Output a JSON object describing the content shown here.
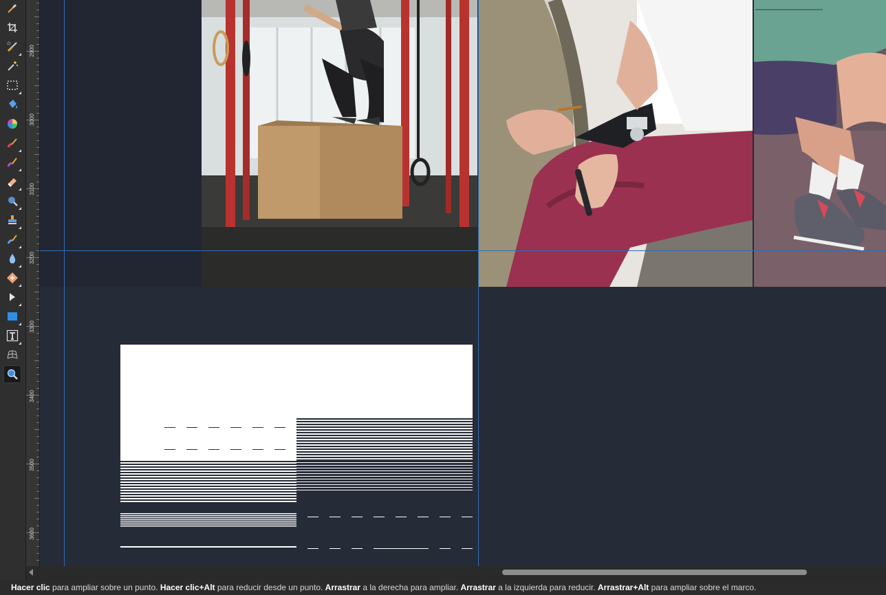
{
  "toolbar": {
    "tools": [
      {
        "name": "color-picker-tool",
        "icon": "eyedropper-icon"
      },
      {
        "name": "crop-tool",
        "icon": "crop-icon"
      },
      {
        "name": "selection-brush-tool",
        "icon": "selection-brush-icon"
      },
      {
        "name": "flood-select-tool",
        "icon": "magic-wand-icon"
      },
      {
        "name": "marquee-tool",
        "icon": "rectangle-marquee-icon"
      },
      {
        "name": "flood-fill-tool",
        "icon": "paint-bucket-icon"
      },
      {
        "name": "gradient-tool",
        "icon": "color-wheel-icon"
      },
      {
        "name": "paint-brush-tool",
        "icon": "paint-brush-icon"
      },
      {
        "name": "pixel-brush-tool",
        "icon": "brush-icon"
      },
      {
        "name": "erase-brush-tool",
        "icon": "eraser-icon"
      },
      {
        "name": "dodge-tool",
        "icon": "magnifier-dodge-icon"
      },
      {
        "name": "clone-tool",
        "icon": "clone-stamp-icon"
      },
      {
        "name": "retouch-tool",
        "icon": "retouch-brush-icon"
      },
      {
        "name": "blur-tool",
        "icon": "water-drop-icon"
      },
      {
        "name": "healing-tool",
        "icon": "healing-patch-icon"
      },
      {
        "name": "move-tool",
        "icon": "arrow-pointer-icon"
      },
      {
        "name": "rectangle-tool",
        "icon": "rectangle-shape-icon"
      },
      {
        "name": "text-tool",
        "icon": "text-icon"
      },
      {
        "name": "mesh-warp-tool",
        "icon": "mesh-warp-icon"
      },
      {
        "name": "zoom-tool",
        "icon": "zoom-icon",
        "active": true
      }
    ]
  },
  "ruler": {
    "labels": [
      "2900",
      "3000",
      "3100",
      "3200",
      "3300",
      "3400",
      "3500",
      "3600"
    ]
  },
  "colors": {
    "canvas_bg": "#262b38",
    "guide": "#2f6db5",
    "ui_panel": "#2f2f2f"
  },
  "canvas": {
    "images": [
      {
        "name": "photo-box-jump-gym"
      },
      {
        "name": "photo-glucose-meter-woman"
      },
      {
        "name": "photo-sneakers-man"
      },
      {
        "name": "placeholder-text-graphic"
      }
    ]
  },
  "scrollbar": {
    "thumb_fraction": 0.36,
    "position_fraction": 0.51
  },
  "status": {
    "p1_b": "Hacer clic",
    "p1": " para ampliar sobre un punto. ",
    "p2_b": "Hacer clic+Alt",
    "p2": " para reducir desde un punto. ",
    "p3_b": "Arrastrar",
    "p3": " a la derecha para ampliar. ",
    "p4_b": "Arrastrar",
    "p4": " a la izquierda para reducir. ",
    "p5_b": "Arrastrar+Alt",
    "p5": " para ampliar sobre el marco."
  }
}
